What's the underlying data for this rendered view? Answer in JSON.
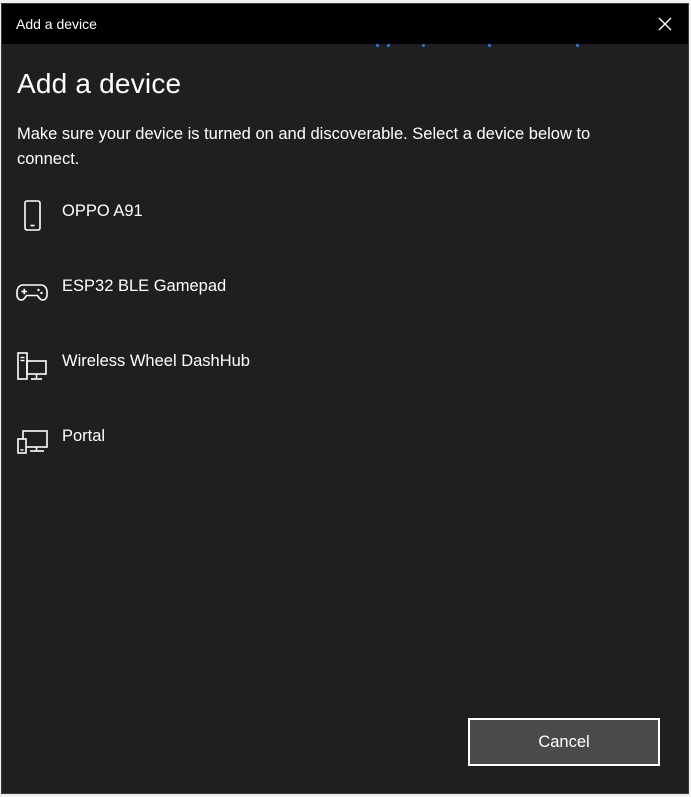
{
  "window": {
    "title": "Add a device",
    "close_icon": "close-icon"
  },
  "main": {
    "heading": "Add a device",
    "instructions": "Make sure your device is turned on and discoverable. Select a device below to connect."
  },
  "devices": [
    {
      "label": "OPPO A91",
      "icon": "phone-icon"
    },
    {
      "label": "ESP32 BLE Gamepad",
      "icon": "gamepad-icon"
    },
    {
      "label": "Wireless Wheel DashHub",
      "icon": "desktop-computer-icon"
    },
    {
      "label": "Portal",
      "icon": "display-device-icon"
    }
  ],
  "footer": {
    "cancel_label": "Cancel"
  },
  "colors": {
    "background": "#1f1f1f",
    "titlebar": "#000000",
    "accent_dots": "#1f7fe0",
    "text": "#ffffff",
    "button_bg": "#4a4a4a"
  }
}
